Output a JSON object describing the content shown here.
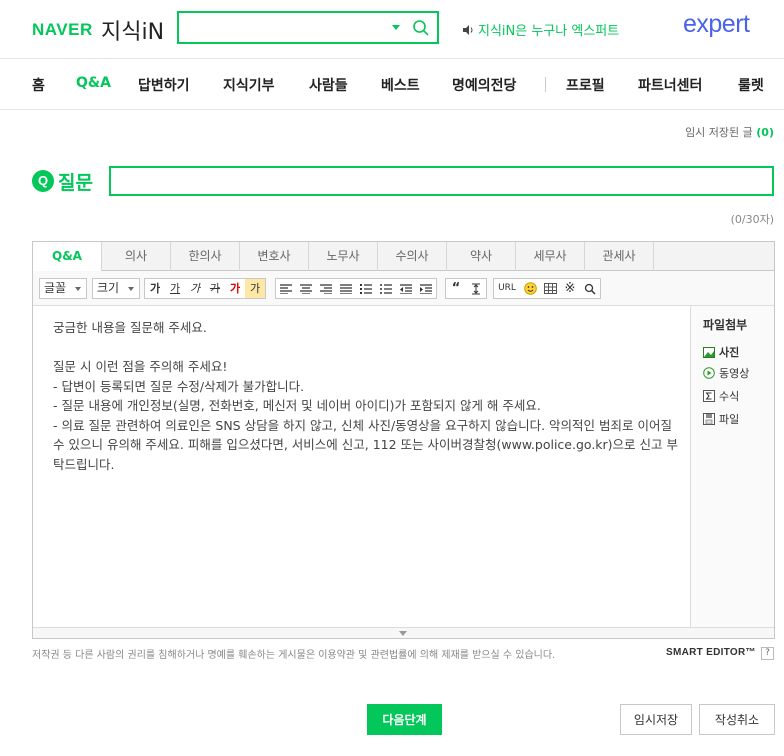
{
  "header": {
    "naver_logo": "NAVER",
    "kin_logo": "지식iN",
    "search": {
      "value": "",
      "placeholder": ""
    },
    "promo_text": "지식iN은 누구나 엑스퍼트",
    "expert_logo": "expert"
  },
  "nav": {
    "items": [
      {
        "label": "홈"
      },
      {
        "label": "Q&A"
      },
      {
        "label": "답변하기"
      },
      {
        "label": "지식기부"
      },
      {
        "label": "사람들"
      },
      {
        "label": "베스트"
      },
      {
        "label": "명예의전당"
      },
      {
        "label": "프로필"
      },
      {
        "label": "파트너센터"
      },
      {
        "label": "룰렛"
      }
    ],
    "active": "Q&A"
  },
  "draft_status": {
    "label": "임시 저장된 글",
    "count": "(0)"
  },
  "question": {
    "badge": "Q",
    "label": "질문",
    "title_value": "",
    "char_count": "(0/30자)"
  },
  "editor": {
    "tabs": [
      {
        "label": "Q&A"
      },
      {
        "label": "의사"
      },
      {
        "label": "한의사"
      },
      {
        "label": "변호사"
      },
      {
        "label": "노무사"
      },
      {
        "label": "수의사"
      },
      {
        "label": "약사"
      },
      {
        "label": "세무사"
      },
      {
        "label": "관세사"
      }
    ],
    "toolbar": {
      "font_select": "글꼴",
      "size_select": "크기",
      "text_buttons": [
        "가",
        "가",
        "가",
        "가",
        "가",
        "가"
      ],
      "url_button": "URL"
    },
    "body_placeholder": "궁금한 내용을 질문해 주세요.\n\n질문 시 이런 점을 주의해 주세요!\n- 답변이 등록되면 질문 수정/삭제가 불가합니다.\n- 질문 내용에 개인정보(실명, 전화번호, 메신저 및 네이버 아이디)가 포함되지 않게 해 주세요.\n- 의료 질문 관련하여 의료인은 SNS 상담을 하지 않고, 신체 사진/동영상을 요구하지 않습니다. 악의적인 범죄로 이어질 수 있으니 유의해 주세요. 피해를 입으셨다면, 서비스에 신고, 112 또는 사이버경찰청(www.police.go.kr)으로 신고 부탁드립니다.",
    "attachments": {
      "title": "파일첨부",
      "items": [
        {
          "label": "사진",
          "icon": "photo-icon"
        },
        {
          "label": "동영상",
          "icon": "video-icon"
        },
        {
          "label": "수식",
          "icon": "formula-icon"
        },
        {
          "label": "파일",
          "icon": "file-icon"
        }
      ]
    }
  },
  "notice": "저작권 등 다른 사람의 권리를 침해하거나 명예를 훼손하는 게시물은 이용약관 및 관련법률에 의해 제재를 받으실 수 있습니다.",
  "smart_editor_label": "SMART EDITOR™",
  "help_label": "?",
  "buttons": {
    "next": "다음단계",
    "temp_save": "임시저장",
    "cancel": "작성취소"
  },
  "colors": {
    "brand_green": "#03c75a",
    "expert_blue": "#4b63e6"
  }
}
